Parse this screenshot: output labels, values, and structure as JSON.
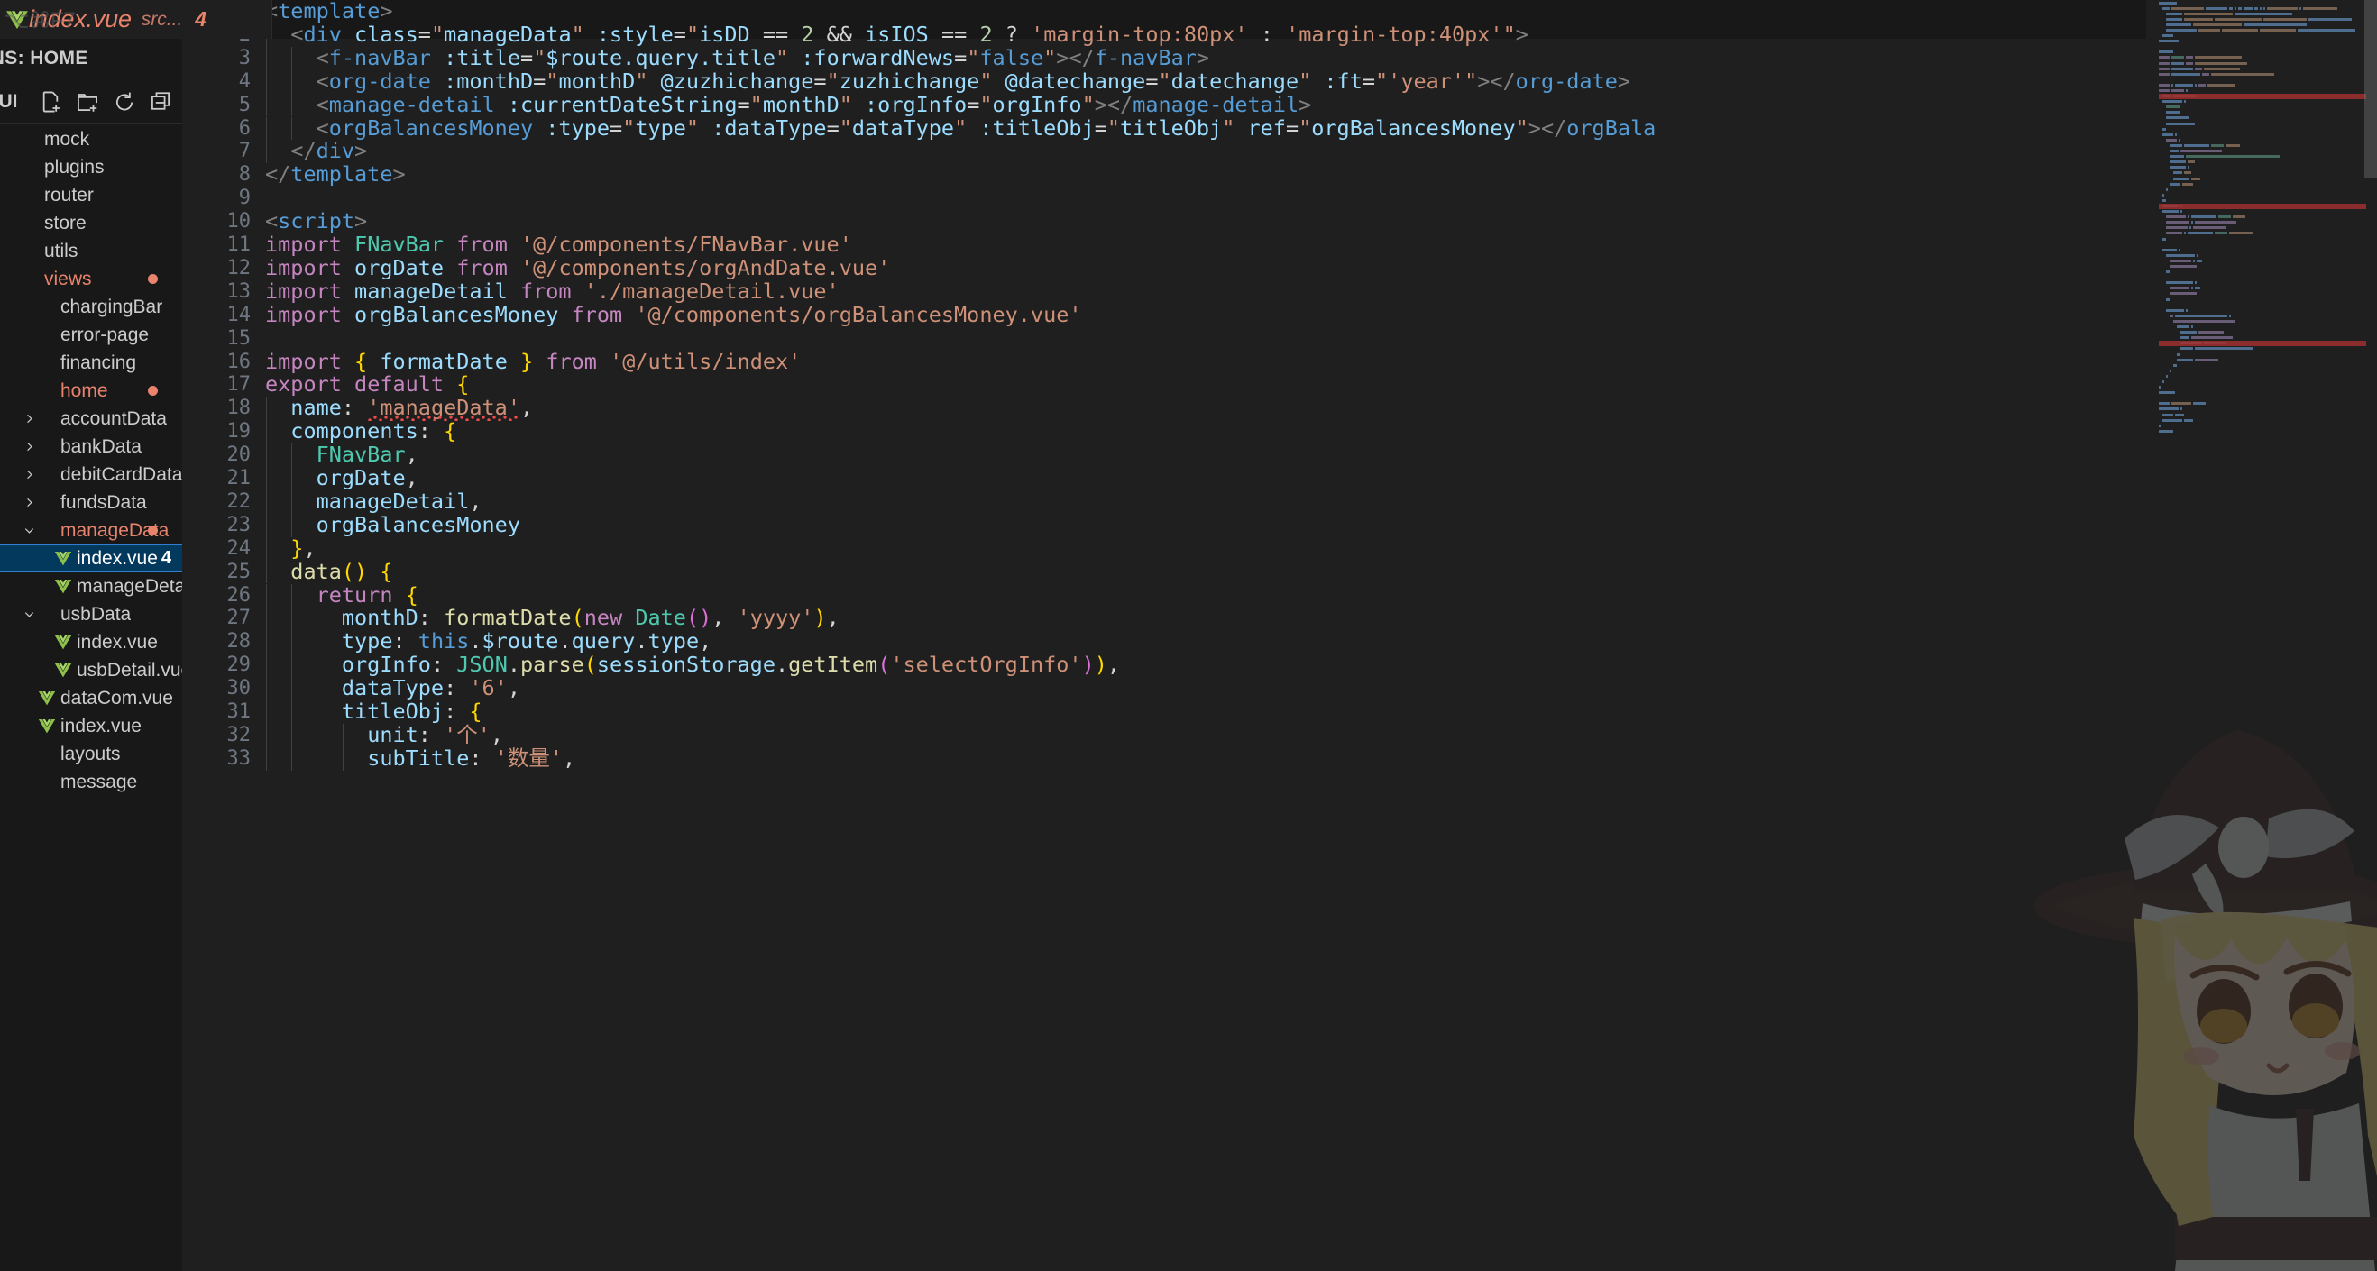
{
  "window": {
    "tab": {
      "icon": "vue-file-icon",
      "filename": "index.vue",
      "path": "src...",
      "problem_count": "4",
      "ghost_shortcut": "⌥⌘F7"
    }
  },
  "sidebar": {
    "title": "LENS: HOME",
    "explorer_label": "MEUI",
    "actions": [
      {
        "name": "new-file-icon",
        "tooltip": "New File"
      },
      {
        "name": "new-folder-icon",
        "tooltip": "New Folder"
      },
      {
        "name": "refresh-icon",
        "tooltip": "Refresh Explorer"
      },
      {
        "name": "collapse-all-icon",
        "tooltip": "Collapse Folders in Explorer"
      }
    ],
    "tree": [
      {
        "label": "mock",
        "indent": 0,
        "type": "folder",
        "twisty": "none",
        "modified": false,
        "dot": false,
        "selected": false
      },
      {
        "label": "plugins",
        "indent": 0,
        "type": "folder",
        "twisty": "none",
        "modified": false,
        "dot": false,
        "selected": false
      },
      {
        "label": "router",
        "indent": 0,
        "type": "folder",
        "twisty": "none",
        "modified": false,
        "dot": false,
        "selected": false
      },
      {
        "label": "store",
        "indent": 0,
        "type": "folder",
        "twisty": "none",
        "modified": false,
        "dot": false,
        "selected": false
      },
      {
        "label": "utils",
        "indent": 0,
        "type": "folder",
        "twisty": "none",
        "modified": false,
        "dot": false,
        "selected": false
      },
      {
        "label": "views",
        "indent": 0,
        "type": "folder",
        "twisty": "none",
        "modified": true,
        "dot": true,
        "selected": false
      },
      {
        "label": "chargingBar",
        "indent": 1,
        "type": "folder",
        "twisty": "none",
        "modified": false,
        "dot": false,
        "selected": false
      },
      {
        "label": "error-page",
        "indent": 1,
        "type": "folder",
        "twisty": "none",
        "modified": false,
        "dot": false,
        "selected": false
      },
      {
        "label": "financing",
        "indent": 1,
        "type": "folder",
        "twisty": "none",
        "modified": false,
        "dot": false,
        "selected": false
      },
      {
        "label": "home",
        "indent": 1,
        "type": "folder",
        "twisty": "none",
        "modified": true,
        "dot": true,
        "selected": false
      },
      {
        "label": "accountData",
        "indent": 1,
        "type": "folder",
        "twisty": "collapsed",
        "modified": false,
        "dot": false,
        "selected": false
      },
      {
        "label": "bankData",
        "indent": 1,
        "type": "folder",
        "twisty": "collapsed",
        "modified": false,
        "dot": false,
        "selected": false
      },
      {
        "label": "debitCardData",
        "indent": 1,
        "type": "folder",
        "twisty": "collapsed",
        "modified": false,
        "dot": false,
        "selected": false
      },
      {
        "label": "fundsData",
        "indent": 1,
        "type": "folder",
        "twisty": "collapsed",
        "modified": false,
        "dot": false,
        "selected": false
      },
      {
        "label": "manageData",
        "indent": 1,
        "type": "folder",
        "twisty": "expanded",
        "modified": true,
        "dot": true,
        "selected": false
      },
      {
        "label": "index.vue",
        "indent": 2,
        "type": "vue",
        "twisty": "none",
        "modified": false,
        "dot": false,
        "selected": true,
        "count": "4"
      },
      {
        "label": "manageDetail.vue",
        "indent": 2,
        "type": "vue",
        "twisty": "none",
        "modified": false,
        "dot": false,
        "selected": false
      },
      {
        "label": "usbData",
        "indent": 1,
        "type": "folder",
        "twisty": "expanded",
        "modified": false,
        "dot": false,
        "selected": false
      },
      {
        "label": "index.vue",
        "indent": 2,
        "type": "vue",
        "twisty": "none",
        "modified": false,
        "dot": false,
        "selected": false
      },
      {
        "label": "usbDetail.vue",
        "indent": 2,
        "type": "vue",
        "twisty": "none",
        "modified": false,
        "dot": false,
        "selected": false
      },
      {
        "label": "dataCom.vue",
        "indent": 1,
        "type": "vue",
        "twisty": "none",
        "modified": false,
        "dot": false,
        "selected": false
      },
      {
        "label": "index.vue",
        "indent": 1,
        "type": "vue",
        "twisty": "none",
        "modified": false,
        "dot": false,
        "selected": false
      },
      {
        "label": "layouts",
        "indent": 1,
        "type": "folder",
        "twisty": "none",
        "modified": false,
        "dot": false,
        "selected": false
      },
      {
        "label": "message",
        "indent": 1,
        "type": "folder",
        "twisty": "none",
        "modified": false,
        "dot": false,
        "selected": false
      }
    ]
  },
  "editor": {
    "first_line_number": 1,
    "current_line": 1,
    "lines": [
      {
        "n": 1,
        "text": "<template>"
      },
      {
        "n": 2,
        "text": "  <div class=\"manageData\" :style=\"isDD == 2 && isIOS == 2 ? 'margin-top:80px' : 'margin-top:40px'\">"
      },
      {
        "n": 3,
        "text": "    <f-navBar :title=\"$route.query.title\" :forwardNews=\"false\"></f-navBar>"
      },
      {
        "n": 4,
        "text": "    <org-date :monthD=\"monthD\" @zuzhichange=\"zuzhichange\" @datechange=\"datechange\" :ft=\"'year'\"></org-date>"
      },
      {
        "n": 5,
        "text": "    <manage-detail :currentDateString=\"monthD\" :orgInfo=\"orgInfo\"></manage-detail>"
      },
      {
        "n": 6,
        "text": "    <orgBalancesMoney :type=\"type\" :dataType=\"dataType\" :titleObj=\"titleObj\" ref=\"orgBalancesMoney\"></orgBala"
      },
      {
        "n": 7,
        "text": "  </div>"
      },
      {
        "n": 8,
        "text": "</template>"
      },
      {
        "n": 9,
        "text": ""
      },
      {
        "n": 10,
        "text": "<script>"
      },
      {
        "n": 11,
        "text": "import FNavBar from '@/components/FNavBar.vue'"
      },
      {
        "n": 12,
        "text": "import orgDate from '@/components/orgAndDate.vue'"
      },
      {
        "n": 13,
        "text": "import manageDetail from './manageDetail.vue'"
      },
      {
        "n": 14,
        "text": "import orgBalancesMoney from '@/components/orgBalancesMoney.vue'"
      },
      {
        "n": 15,
        "text": ""
      },
      {
        "n": 16,
        "text": "import { formatDate } from '@/utils/index'"
      },
      {
        "n": 17,
        "text": "export default {"
      },
      {
        "n": 18,
        "text": "  name: 'manageData',"
      },
      {
        "n": 19,
        "text": "  components: {"
      },
      {
        "n": 20,
        "text": "    FNavBar,"
      },
      {
        "n": 21,
        "text": "    orgDate,"
      },
      {
        "n": 22,
        "text": "    manageDetail,"
      },
      {
        "n": 23,
        "text": "    orgBalancesMoney"
      },
      {
        "n": 24,
        "text": "  },"
      },
      {
        "n": 25,
        "text": "  data() {"
      },
      {
        "n": 26,
        "text": "    return {"
      },
      {
        "n": 27,
        "text": "      monthD: formatDate(new Date(), 'yyyy'),"
      },
      {
        "n": 28,
        "text": "      type: this.$route.query.type,"
      },
      {
        "n": 29,
        "text": "      orgInfo: JSON.parse(sessionStorage.getItem('selectOrgInfo')),"
      },
      {
        "n": 30,
        "text": "      dataType: '6',"
      },
      {
        "n": 31,
        "text": "      titleObj: {"
      },
      {
        "n": 32,
        "text": "        unit: '个',"
      },
      {
        "n": 33,
        "text": "        subTitle: '数量',"
      }
    ],
    "error_lines": [
      18
    ]
  },
  "minimap": {
    "error_bands": [
      18,
      38,
      63
    ],
    "visible": true
  },
  "colors": {
    "accent_modified": "#e9836c",
    "selection_bg": "#04395e",
    "selection_border": "#2f7fd1",
    "editor_bg": "#1f1f1f",
    "sidebar_bg": "#181818",
    "error": "#f14c4c"
  },
  "overlay": {
    "character": "anime-chibi-witch-character"
  }
}
